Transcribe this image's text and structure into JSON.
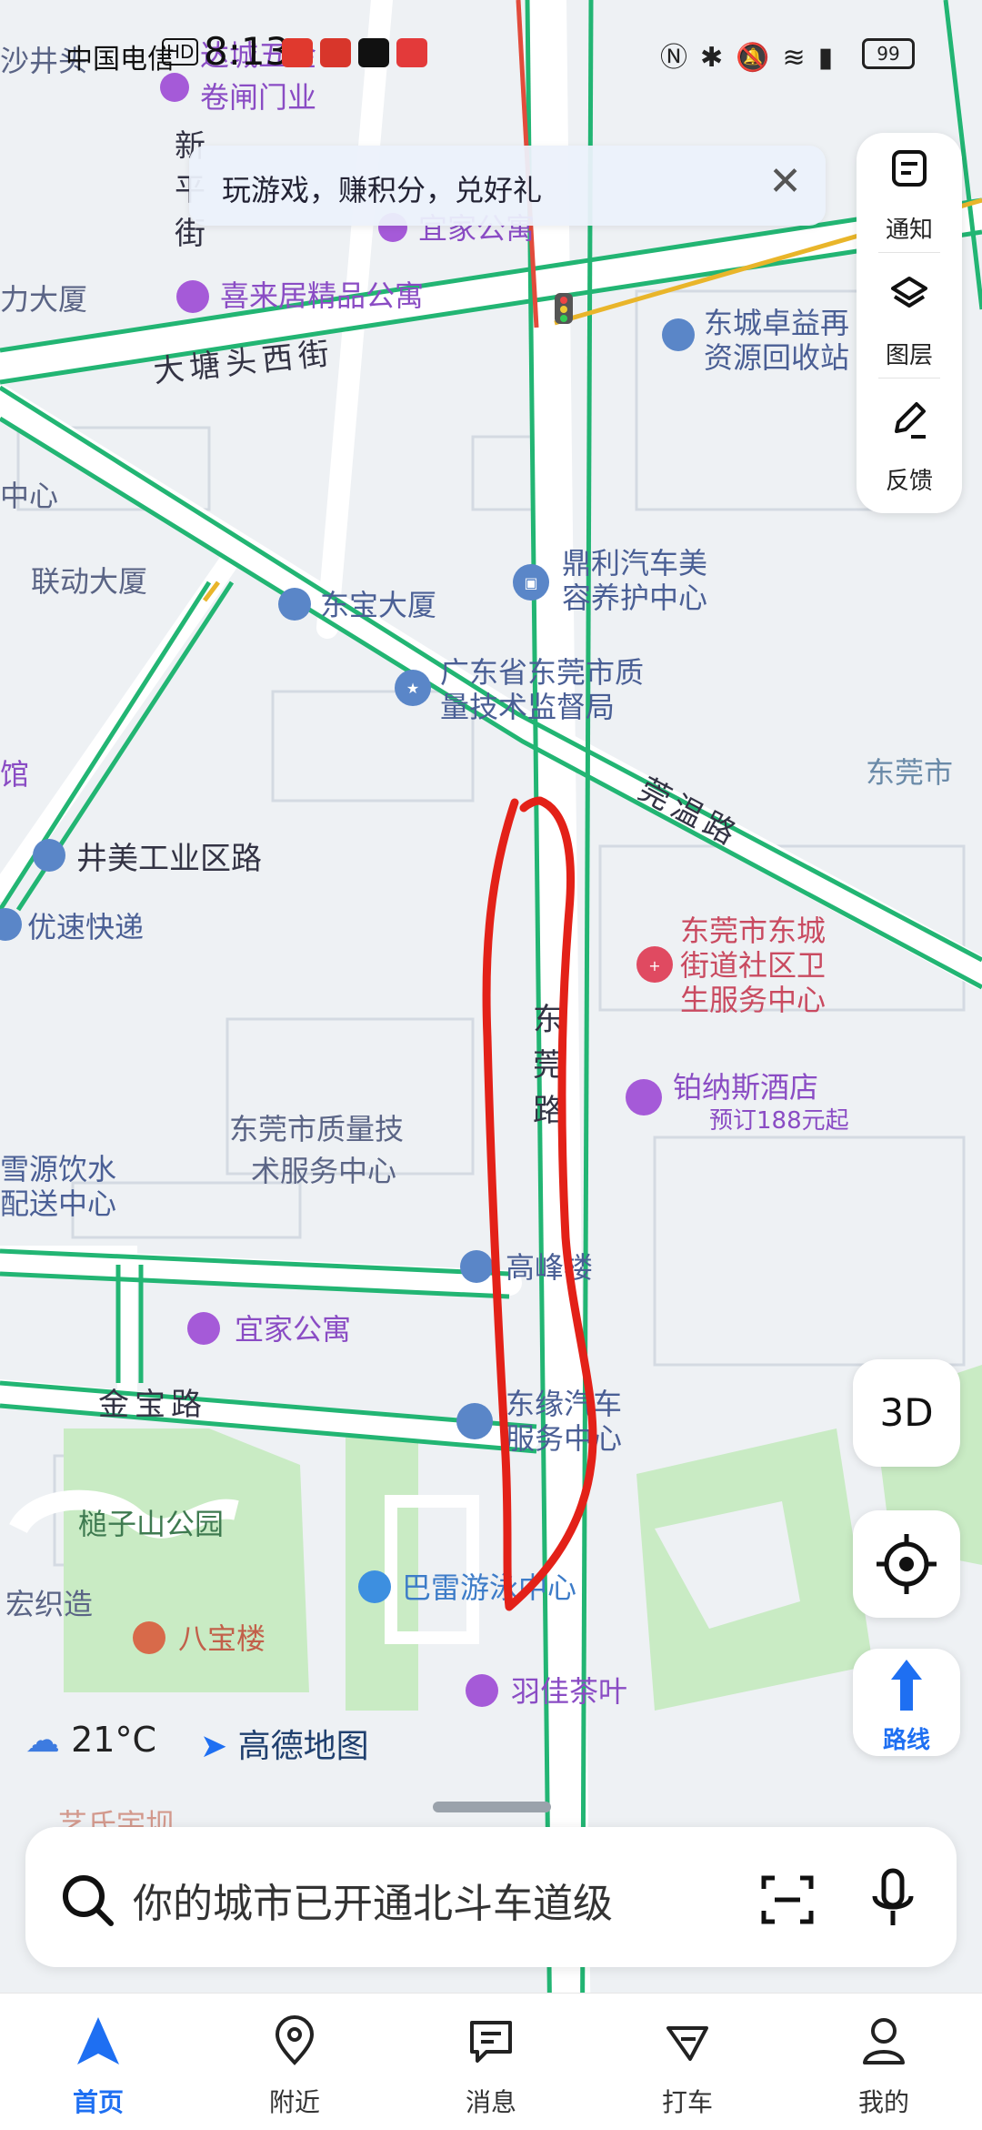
{
  "status_bar": {
    "carrier": "中国电信",
    "network_badge": "HD",
    "time": "8:13",
    "battery": "99"
  },
  "banner": {
    "text": "玩游戏，赚积分，兑好礼"
  },
  "tools": [
    {
      "label": "通知",
      "icon": "notification-icon"
    },
    {
      "label": "图层",
      "icon": "layers-icon"
    },
    {
      "label": "反馈",
      "icon": "feedback-icon"
    }
  ],
  "buttons": {
    "three_d": "3D",
    "locate_icon": "locate-icon",
    "route_label": "路线"
  },
  "weather": {
    "temp": "21°C"
  },
  "brand": {
    "name": "高德地图"
  },
  "search": {
    "placeholder": "你的城市已开通北斗车道级"
  },
  "nav": [
    {
      "label": "首页",
      "icon": "home-arrow-icon",
      "active": true
    },
    {
      "label": "附近",
      "icon": "location-pin-icon",
      "active": false
    },
    {
      "label": "消息",
      "icon": "message-icon",
      "active": false
    },
    {
      "label": "打车",
      "icon": "taxi-icon",
      "active": false
    },
    {
      "label": "我的",
      "icon": "profile-icon",
      "active": false
    }
  ],
  "map": {
    "roads": {
      "datangtou": "大塘头西街",
      "guanwen": "莞温路",
      "jinbao": "金宝路",
      "jingmei": "井美工业区路",
      "xin_jie": [
        "新",
        "平",
        "街"
      ],
      "dong_road": [
        "东",
        "莞",
        "路"
      ]
    },
    "pois": {
      "shajing": "沙井头",
      "dacheng_1": "达城五金",
      "dacheng_2": "卷闸门业",
      "yijia_top": "宜家公寓",
      "li_dasha": "力大厦",
      "xilaiju": "喜来居精品公寓",
      "zhuoyi_1": "东城卓益再",
      "zhuoyi_2": "资源回收站",
      "zhongxin": "中心",
      "liandong": "联动大厦",
      "dongbao": "东宝大厦",
      "dingli_1": "鼎利汽车美",
      "dingli_2": "容养护中心",
      "zhiliang_1": "广东省东莞市质",
      "zhiliang_2": "量技术监督局",
      "dongguan_shi": "东莞市",
      "guan": "馆",
      "yousu": "优速快递",
      "shequ_1": "东莞市东城",
      "shequ_2": "街道社区卫",
      "shequ_3": "生服务中心",
      "bonasi": "铂纳斯酒店",
      "bonasi_promo": "预订188元起",
      "jishu_1": "东莞市质量技",
      "jishu_2": "术服务中心",
      "xueyuan_1": "雪源饮水",
      "xueyuan_2": "配送中心",
      "gaofeng": "高峰楼",
      "yijia": "宜家公寓",
      "dongyuan_1": "东缘汽车",
      "dongyuan_2": "服务中心",
      "pingzi": "槌子山公园",
      "hongzhi": "宏织造",
      "babao": "八宝楼",
      "balei": "巴雷游泳中心",
      "yujia": "羽佳茶叶",
      "bottom_cut": "艺氏宇坝"
    }
  }
}
